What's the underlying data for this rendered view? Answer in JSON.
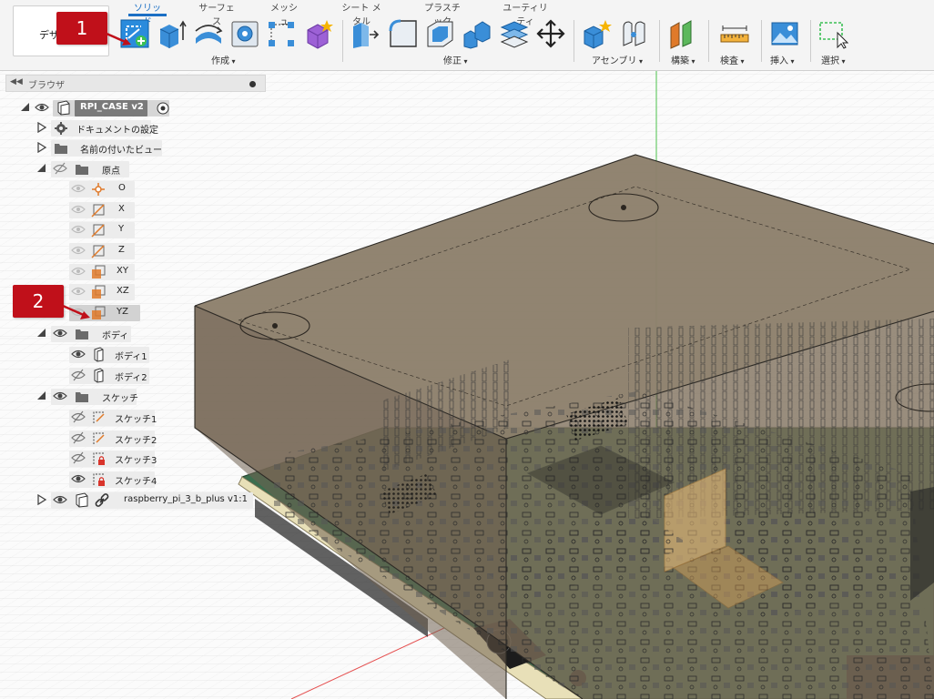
{
  "workspace": {
    "label": "デザ"
  },
  "tabs": [
    "ソリッド",
    "サーフェス",
    "メッシュ",
    "シート メタル",
    "プラスチック",
    "ユーティリティ"
  ],
  "active_tab": 0,
  "groups": {
    "create": "作成",
    "modify": "修正",
    "assemble": "アセンブリ",
    "construct": "構築",
    "inspect": "検査",
    "insert": "挿入",
    "select": "選択"
  },
  "colors": {
    "accent": "#1b6fc4",
    "badge": "#c0101a",
    "origin_orange": "#e07a2a"
  },
  "callouts": [
    "1",
    "2"
  ],
  "browser": {
    "title": "ブラウザ",
    "root": "RPI_CASE v2",
    "doc_settings": "ドキュメントの設定",
    "named_views": "名前の付いたビュー",
    "origin": "原点",
    "origin_items": [
      "O",
      "X",
      "Y",
      "Z",
      "XY",
      "XZ",
      "YZ"
    ],
    "bodies": "ボディ",
    "body_items": [
      "ボディ1",
      "ボディ2"
    ],
    "sketches": "スケッチ",
    "sketch_items": [
      "スケッチ1",
      "スケッチ2",
      "スケッチ3",
      "スケッチ4"
    ],
    "component": "raspberry_pi_3_b_plus v1:1"
  }
}
